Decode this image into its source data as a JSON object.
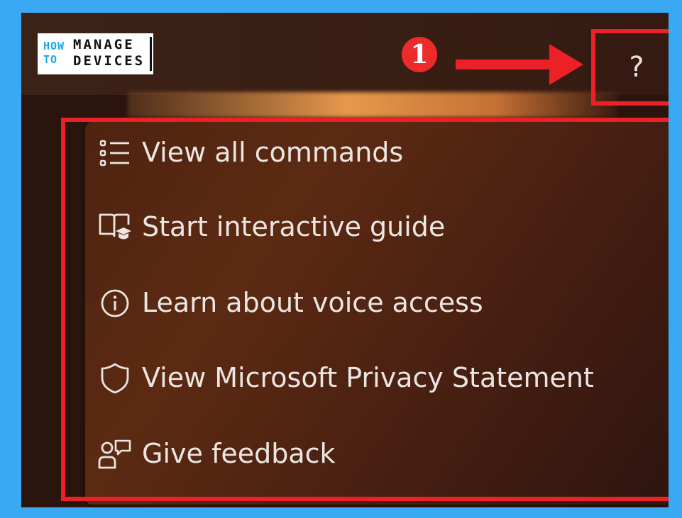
{
  "logo": {
    "how": "HOW",
    "to": "TO",
    "line1": "MANAGE",
    "line2": "DEVICES"
  },
  "annotation": {
    "step_number": "1",
    "accent_color": "#ec2027"
  },
  "toolbar": {
    "help_label": "?"
  },
  "help_menu": {
    "items": [
      {
        "label": "View all commands",
        "icon": "list-icon"
      },
      {
        "label": "Start interactive guide",
        "icon": "book-guide-icon"
      },
      {
        "label": "Learn about voice access",
        "icon": "info-icon"
      },
      {
        "label": "View Microsoft Privacy Statement",
        "icon": "shield-icon"
      },
      {
        "label": "Give feedback",
        "icon": "feedback-icon"
      }
    ]
  },
  "colors": {
    "page_background": "#3aa9f3",
    "menu_text": "#ece6e3",
    "logo_how_blue": "#1fa3e8"
  }
}
